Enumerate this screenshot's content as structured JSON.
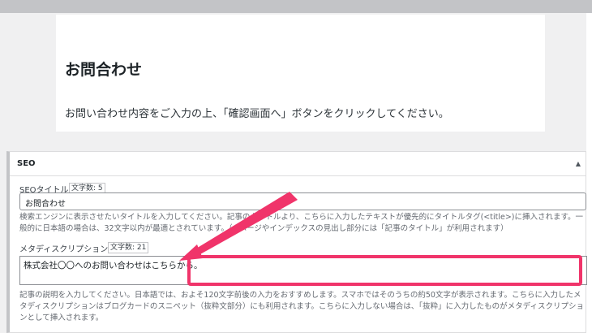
{
  "preview": {
    "title": "お問合わせ",
    "description": "お問い合わせ内容をご入力の上、「確認画面へ」ボタンをクリックしてください。"
  },
  "seo": {
    "panel_title": "SEO",
    "collapse_icon": "triangle-up-icon",
    "seo_title": {
      "label": "SEOタイトル",
      "count": "文字数: 5",
      "value": "お問合わせ",
      "help": "検索エンジンに表示させたいタイトルを入力してください。記事のタイトルより、こちらに入力したテキストが優先的にタイトルタグ(<title>)に挿入されます。一般的に日本語の場合は、32文字以内が最適とされています。（※ページやインデックスの見出し部分には「記事のタイトル」が利用されます）"
    },
    "meta_description": {
      "label": "メタディスクリプション",
      "count": "文字数: 21",
      "value": "株式会社〇〇へのお問い合わせはこちらから。",
      "help": "記事の説明を入力してください。日本語では、およそ120文字前後の入力をおすすめします。スマホではそのうちの約50文字が表示されます。こちらに入力したメタディスクリプションはブログカードのスニペット（抜粋文部分）にも利用されます。こちらに入力しない場合は、「抜粋」に入力したものがメタディスクリプションとして挿入されます。"
    }
  },
  "annotation": {
    "highlight_color": "#f0346a"
  }
}
